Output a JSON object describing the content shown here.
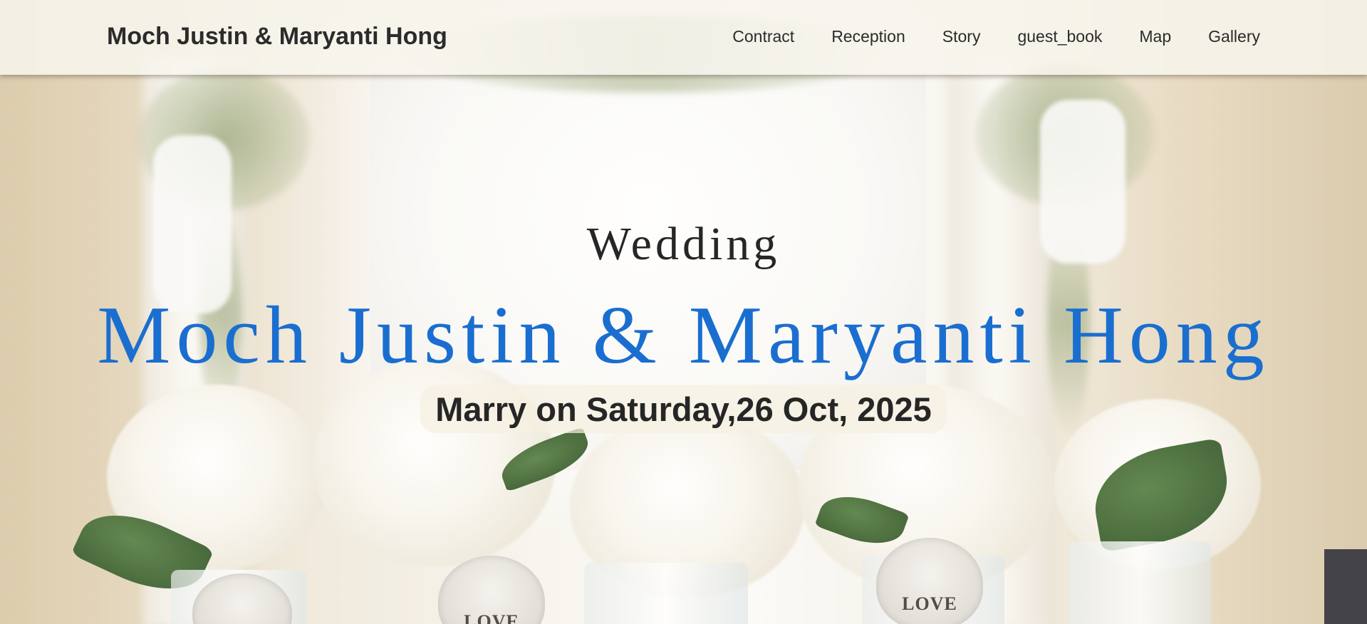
{
  "navbar": {
    "brand": "Moch Justin & Maryanti Hong",
    "links": [
      {
        "label": "Contract"
      },
      {
        "label": "Reception"
      },
      {
        "label": "Story"
      },
      {
        "label": "guest_book"
      },
      {
        "label": "Map"
      },
      {
        "label": "Gallery"
      }
    ]
  },
  "hero": {
    "kicker": "Wedding",
    "names": "Moch Justin & Maryanti Hong",
    "date": "Marry on Saturday,26 Oct, 2025",
    "photo_tags": [
      "LOVE",
      "LOVE"
    ]
  },
  "colors": {
    "names_accent": "#1a6ed0",
    "text_dark": "#262626",
    "navbar_bg": "#f7f4ec"
  }
}
